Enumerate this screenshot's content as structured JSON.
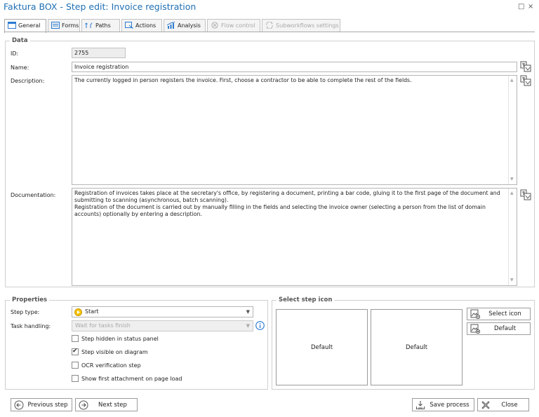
{
  "window": {
    "title": "Faktura BOX - Step edit: Invoice registration",
    "restore_glyph": "□",
    "close_glyph": "×"
  },
  "tabs": [
    {
      "label": "General",
      "icon": "window-icon",
      "active": true
    },
    {
      "label": "Forms",
      "icon": "form-icon"
    },
    {
      "label": "Paths",
      "icon": "paths-icon"
    },
    {
      "label": "Actions",
      "icon": "actions-icon"
    },
    {
      "label": "Analysis",
      "icon": "analysis-chart-icon"
    },
    {
      "label": "Flow control",
      "icon": "flow-control-icon",
      "disabled": true
    },
    {
      "label": "Subworkflows settings",
      "icon": "subworkflows-icon",
      "disabled": true
    }
  ],
  "data_section": {
    "legend": "Data",
    "id_label": "ID:",
    "id_value": "2755",
    "name_label": "Name:",
    "name_value": "Invoice registration",
    "description_label": "Description:",
    "description_value": "The currently logged in person registers the invoice. First, choose a contractor to be able to complete the rest of the fields.",
    "documentation_label": "Documentation:",
    "documentation_value": "Registration of invoices takes place at the secretary's office, by registering a document, printing a bar code, gluing it to the first page of the document and submitting to scanning (asynchronous, batch scanning).\nRegistration of the document is carried out by manually filling in the fields and selecting the invoice owner (selecting a person from the list of domain accounts) optionally by entering a description."
  },
  "properties": {
    "legend": "Properties",
    "step_type_label": "Step type:",
    "step_type_value": "Start",
    "task_handling_label": "Task handling:",
    "task_handling_value": "Wait for tasks finish",
    "checkboxes": [
      {
        "label": "Step hidden in status panel",
        "checked": false
      },
      {
        "label": "Step visible on diagram",
        "checked": true
      },
      {
        "label": "OCR verification step",
        "checked": false
      },
      {
        "label": "Show first attachment on page load",
        "checked": false
      }
    ]
  },
  "step_icon": {
    "legend": "Select step icon",
    "preview1_caption": "Default",
    "preview2_caption": "Default",
    "select_icon_label": "Select icon",
    "default_label": "Default"
  },
  "footer": {
    "previous_label": "Previous step",
    "next_label": "Next step",
    "save_label": "Save process",
    "close_label": "Close"
  },
  "colors": {
    "title": "#1f6fb5",
    "accent": "#2b7bd0",
    "start_icon": "#f5c400"
  }
}
